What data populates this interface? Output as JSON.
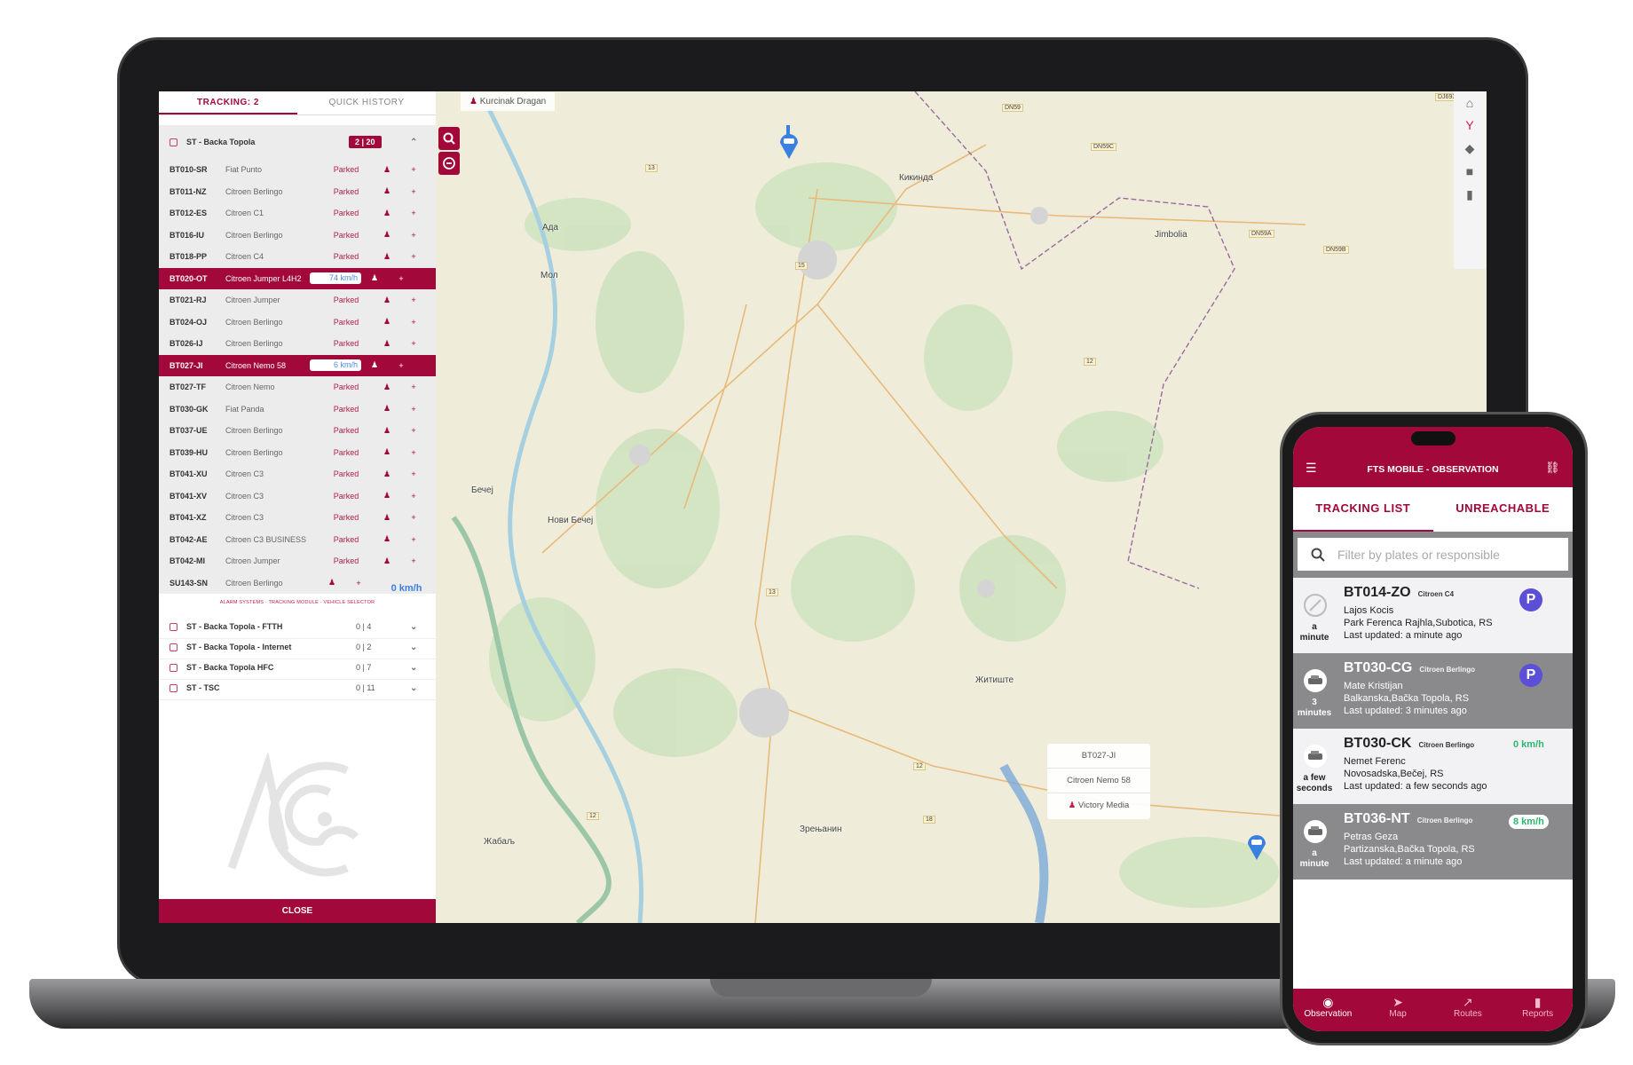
{
  "desktop": {
    "tabs": [
      {
        "label": "TRACKING: 2"
      },
      {
        "label": "QUICK HISTORY"
      }
    ],
    "group": {
      "name": "ST - Backa Topola",
      "badge": "2 | 20"
    },
    "vehicles": [
      {
        "plate": "BT010-SR",
        "model": "Fiat Punto",
        "status": "Parked"
      },
      {
        "plate": "BT011-NZ",
        "model": "Citroen Berlingo",
        "status": "Parked"
      },
      {
        "plate": "BT012-ES",
        "model": "Citroen C1",
        "status": "Parked"
      },
      {
        "plate": "BT016-IU",
        "model": "Citroen Berlingo",
        "status": "Parked"
      },
      {
        "plate": "BT018-PP",
        "model": "Citroen C4",
        "status": "Parked"
      },
      {
        "plate": "BT020-OT",
        "model": "Citroen Jumper L4H2",
        "status": "74 km/h",
        "active": true
      },
      {
        "plate": "BT021-RJ",
        "model": "Citroen Jumper",
        "status": "Parked"
      },
      {
        "plate": "BT024-OJ",
        "model": "Citroen Berlingo",
        "status": "Parked"
      },
      {
        "plate": "BT026-IJ",
        "model": "Citroen Berlingo",
        "status": "Parked"
      },
      {
        "plate": "BT027-JI",
        "model": "Citroen Nemo 58",
        "status": "6 km/h",
        "active": true
      },
      {
        "plate": "BT027-TF",
        "model": "Citroen Nemo",
        "status": "Parked"
      },
      {
        "plate": "BT030-GK",
        "model": "Fiat Panda",
        "status": "Parked"
      },
      {
        "plate": "BT037-UE",
        "model": "Citroen Berlingo",
        "status": "Parked"
      },
      {
        "plate": "BT039-HU",
        "model": "Citroen Berlingo",
        "status": "Parked"
      },
      {
        "plate": "BT041-XU",
        "model": "Citroen C3",
        "status": "Parked"
      },
      {
        "plate": "BT041-XV",
        "model": "Citroen C3",
        "status": "Parked"
      },
      {
        "plate": "BT041-XZ",
        "model": "Citroen C3",
        "status": "Parked"
      },
      {
        "plate": "BT042-AE",
        "model": "Citroen C3 BUSINESS",
        "status": "Parked"
      },
      {
        "plate": "BT042-MI",
        "model": "Citroen Jumper",
        "status": "Parked"
      },
      {
        "plate": "SU143-SN",
        "model": "Citroen Berlingo",
        "status": "0 km/h"
      }
    ],
    "subtitle": "ALARM SYSTEMS · TRACKING MODULE · VEHICLE SELECTOR",
    "other_groups": [
      {
        "name": "ST - Backa Topola - FTTH",
        "count": "0 | 4"
      },
      {
        "name": "ST - Backa Topola - Internet",
        "count": "0 | 2"
      },
      {
        "name": "ST - Backa Topola HFC",
        "count": "0 | 7"
      },
      {
        "name": "ST - TSC",
        "count": "0 | 11"
      }
    ],
    "close_label": "CLOSE",
    "map": {
      "driver_label": "Kurcinak Dragan",
      "labels": [
        "Кикинда",
        "Jimbolia",
        "Ада",
        "Мол",
        "Бечеј",
        "Нови Бечеј",
        "Житиште",
        "Зрењанин",
        "Жабаљ"
      ],
      "road_numbers": [
        "DN59",
        "DN59C",
        "DN59A",
        "DN59B",
        "DJ693",
        "13",
        "15",
        "12",
        "13",
        "12",
        "18",
        "12"
      ],
      "tooltip": {
        "plate": "BT027-JI",
        "model": "Citroen Nemo 58",
        "driver": "Victory Media"
      },
      "toolbar_icons": [
        "home-icon",
        "fork-icon",
        "directions-icon",
        "alert-icon",
        "fuel-icon"
      ]
    }
  },
  "mobile": {
    "title": "FTS MOBILE - OBSERVATION",
    "tabs": [
      {
        "label": "TRACKING LIST"
      },
      {
        "label": "UNREACHABLE"
      }
    ],
    "search_placeholder": "Filter by plates or responsible",
    "cards": [
      {
        "plate": "BT014-ZO",
        "model": "Citroen C4",
        "driver": "Lajos Kocis",
        "address": "Park Ferenca Rajhla,Subotica, RS",
        "updated": "Last updated: a minute ago",
        "ago": [
          "a",
          "minute"
        ],
        "badge": "P"
      },
      {
        "plate": "BT030-CG",
        "model": "Citroen Berlingo",
        "driver": "Mate Kristijan",
        "address": "Balkanska,Bačka Topola, RS",
        "updated": "Last updated: 3 minutes ago",
        "ago": [
          "3",
          "minutes"
        ],
        "badge": "P"
      },
      {
        "plate": "BT030-CK",
        "model": "Citroen Berlingo",
        "driver": "Nemet Ferenc",
        "address": "Novosadska,Bečej, RS",
        "updated": "Last updated: a few seconds ago",
        "ago": [
          "a few",
          "seconds"
        ],
        "speed": "0 km/h"
      },
      {
        "plate": "BT036-NT",
        "model": "Citroen Berlingo",
        "driver": "Petras Geza",
        "address": "Partizanska,Bačka Topola, RS",
        "updated": "Last updated: a minute ago",
        "ago": [
          "a",
          "minute"
        ],
        "speed": "8 km/h"
      }
    ],
    "nav": [
      {
        "label": "Observation",
        "icon": "eye-icon"
      },
      {
        "label": "Map",
        "icon": "navigation-icon"
      },
      {
        "label": "Routes",
        "icon": "routes-icon"
      },
      {
        "label": "Reports",
        "icon": "clipboard-icon"
      }
    ]
  },
  "colors": {
    "brand": "#a2083a",
    "parked": "#b0204a",
    "speed": "#3a80e0",
    "badge": "#5a4fd6",
    "moving": "#2cb870"
  }
}
